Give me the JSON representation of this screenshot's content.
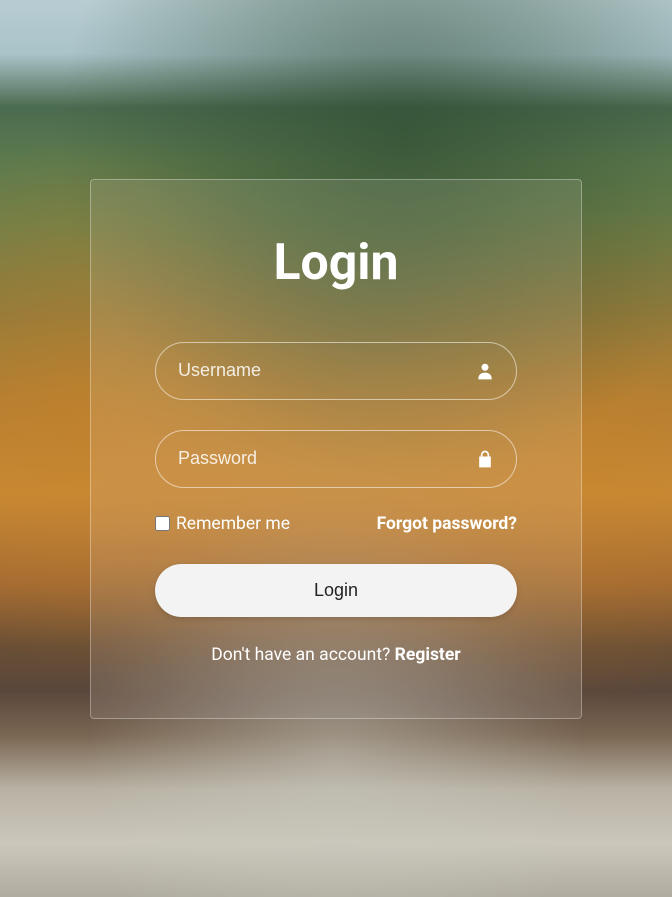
{
  "title": "Login",
  "username": {
    "placeholder": "Username",
    "value": ""
  },
  "password": {
    "placeholder": "Password",
    "value": ""
  },
  "remember_label": "Remember me",
  "forgot_label": "Forgot password?",
  "login_button": "Login",
  "register_prompt": "Don't have an account? ",
  "register_link": "Register"
}
